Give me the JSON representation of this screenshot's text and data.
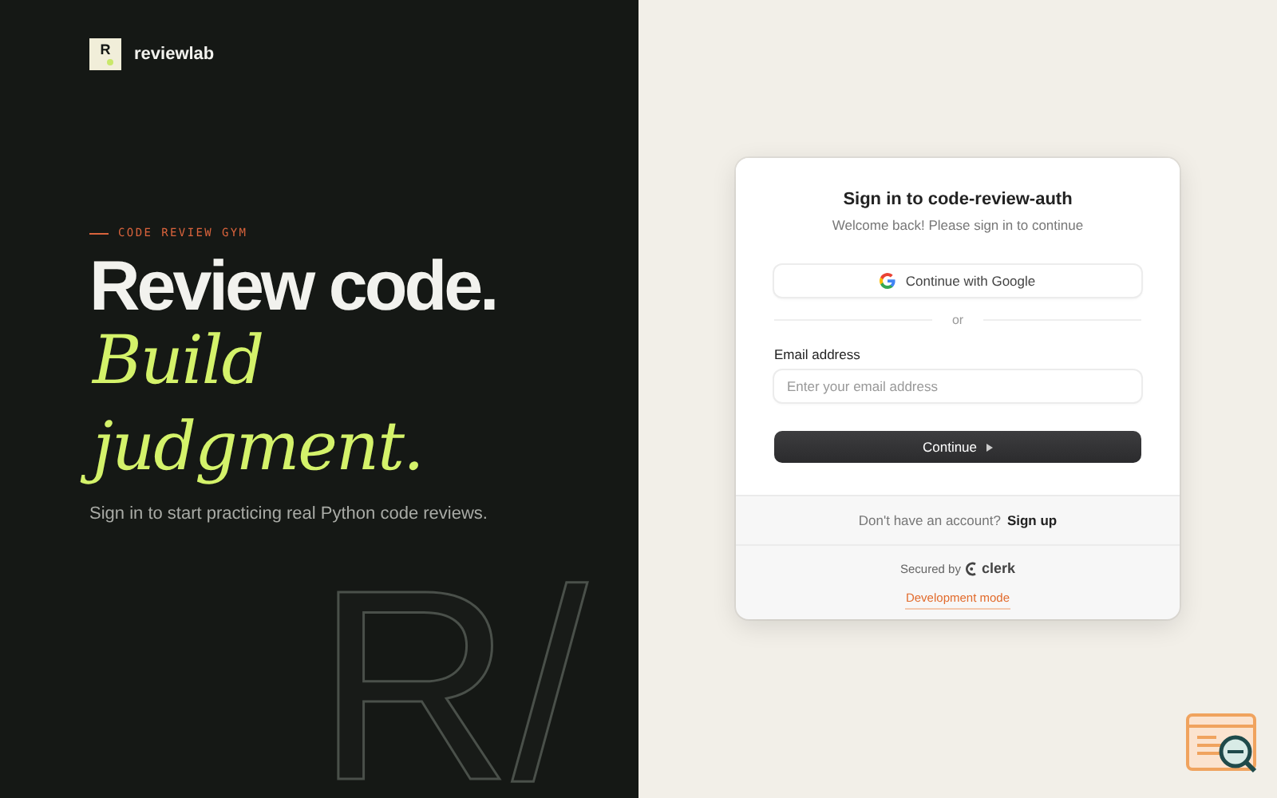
{
  "brand": {
    "mark": "R",
    "name": "reviewlab"
  },
  "hero": {
    "eyebrow": "CODE REVIEW GYM",
    "headline": "Review code.",
    "accent_lines": [
      "Build",
      "judgment."
    ],
    "subtitle": "Sign in to start practicing real Python code reviews.",
    "backdrop_mark": "R/"
  },
  "card": {
    "title": "Sign in to code-review-auth",
    "subtitle": "Welcome back! Please sign in to continue",
    "google_button": "Continue with Google",
    "divider": "or",
    "email_label": "Email address",
    "email_placeholder": "Enter your email address",
    "continue_button": "Continue",
    "signup_prompt": "Don't have an account?",
    "signup_link": "Sign up",
    "secured_by": "Secured by",
    "provider": "clerk",
    "dev_mode": "Development mode"
  }
}
